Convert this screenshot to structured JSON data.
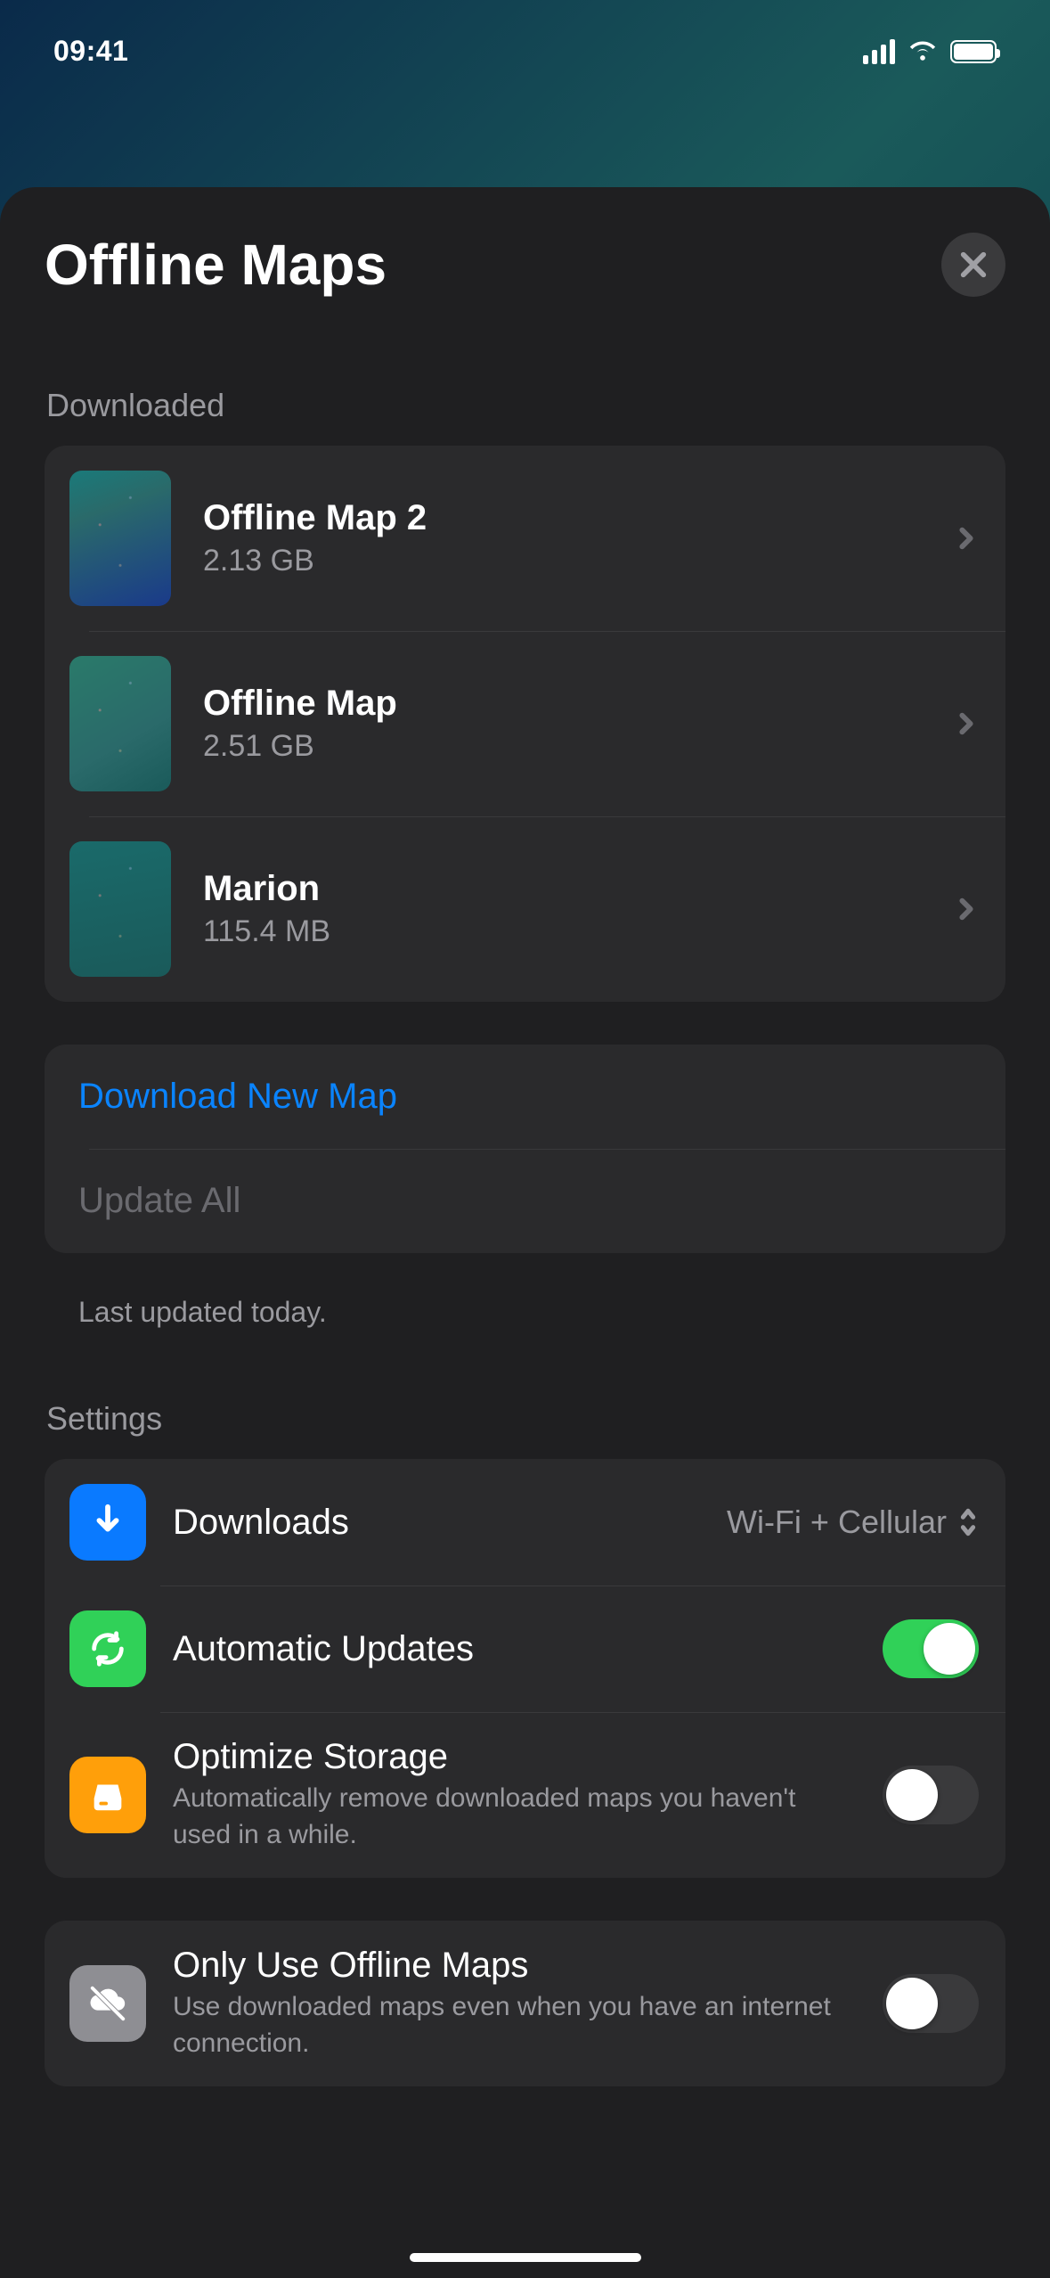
{
  "status": {
    "time": "09:41"
  },
  "header": {
    "title": "Offline Maps"
  },
  "downloaded": {
    "label": "Downloaded",
    "items": [
      {
        "name": "Offline Map 2",
        "size": "2.13 GB"
      },
      {
        "name": "Offline Map",
        "size": "2.51 GB"
      },
      {
        "name": "Marion",
        "size": "115.4 MB"
      }
    ]
  },
  "actions": {
    "download_new": "Download New Map",
    "update_all": "Update All"
  },
  "footer": {
    "last_updated": "Last updated today."
  },
  "settings": {
    "label": "Settings",
    "downloads": {
      "title": "Downloads",
      "value": "Wi-Fi + Cellular"
    },
    "automatic_updates": {
      "title": "Automatic Updates",
      "on": true
    },
    "optimize_storage": {
      "title": "Optimize Storage",
      "sub": "Automatically remove downloaded maps you haven't used in a while.",
      "on": false
    },
    "only_offline": {
      "title": "Only Use Offline Maps",
      "sub": "Use downloaded maps even when you have an internet connection.",
      "on": false
    }
  }
}
